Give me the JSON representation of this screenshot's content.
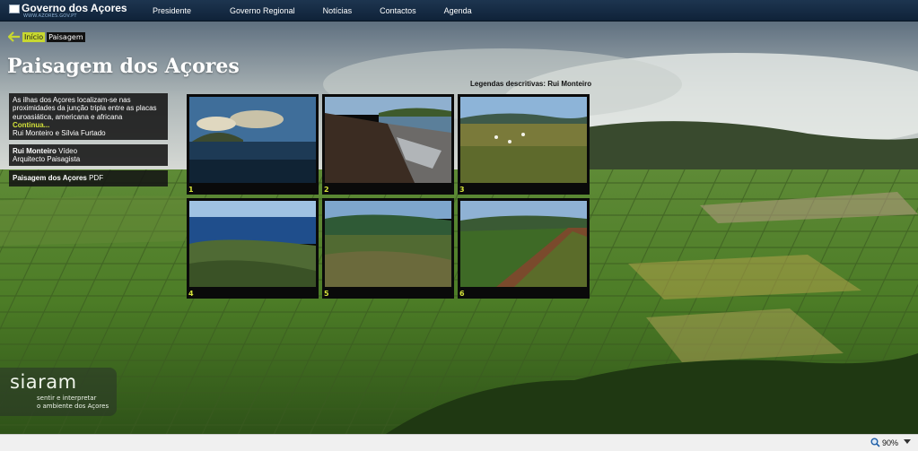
{
  "header": {
    "logo_title": "Governo dos Açores",
    "logo_url": "WWW.AZORES.GOV.PT",
    "nav": [
      "Presidente",
      "Governo Regional",
      "Notícias",
      "Contactos",
      "Agenda"
    ]
  },
  "breadcrumb": {
    "home": "Início",
    "current": "Paisagem"
  },
  "page_title": "Paisagem dos Açores",
  "intro": {
    "text": "As ilhas dos Açores localizam-se nas proximidades da junção tripla entre as placas euroasiática, americana e africana",
    "more_link": "Continua...",
    "authors": "Rui Monteiro e Sílvia Furtado"
  },
  "video": {
    "name": "Rui Monteiro",
    "type": "Vídeo",
    "role": "Arquitecto Paisagista"
  },
  "pdf": {
    "name": "Paisagem dos Açores",
    "type": "PDF"
  },
  "captions_label": "Legendas descritivas: Rui Monteiro",
  "thumbnails": [
    {
      "number": "1",
      "icon": "coastal-island-photo"
    },
    {
      "number": "2",
      "icon": "lava-rock-shore-photo"
    },
    {
      "number": "3",
      "icon": "meadow-flowers-photo"
    },
    {
      "number": "4",
      "icon": "coastline-bay-photo"
    },
    {
      "number": "5",
      "icon": "green-hills-photo"
    },
    {
      "number": "6",
      "icon": "grassy-ridge-photo"
    }
  ],
  "siaram": {
    "wordmark": "siaram",
    "tagline_1": "sentir e interpretar",
    "tagline_2": "o ambiente dos Açores"
  },
  "statusbar": {
    "zoom": "90%"
  },
  "colors": {
    "accent": "#d4e23a",
    "header": "#0f2238",
    "box": "#141414"
  }
}
